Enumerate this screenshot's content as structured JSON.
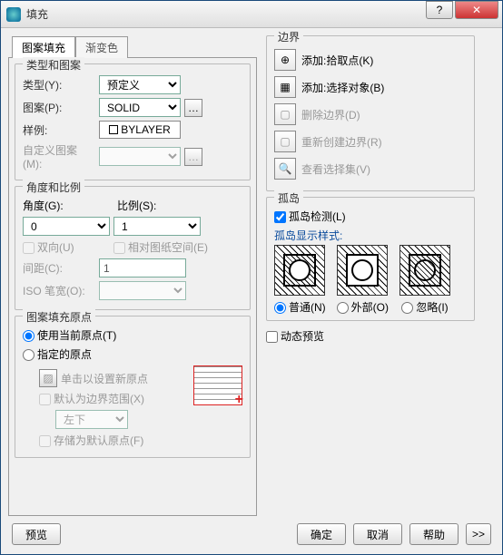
{
  "window": {
    "title": "填充"
  },
  "tabs": {
    "active": "图案填充",
    "inactive": "渐变色"
  },
  "type_pattern": {
    "title": "类型和图案",
    "type_label": "类型(Y):",
    "type_value": "预定义",
    "pattern_label": "图案(P):",
    "pattern_value": "SOLID",
    "sample_label": "样例:",
    "sample_value": "BYLAYER",
    "custom_label": "自定义图案(M):"
  },
  "angle_scale": {
    "title": "角度和比例",
    "angle_label": "角度(G):",
    "angle_value": "0",
    "scale_label": "比例(S):",
    "scale_value": "1",
    "double_label": "双向(U)",
    "paperspace_label": "相对图纸空间(E)",
    "spacing_label": "间距(C):",
    "spacing_value": "1",
    "isowidth_label": "ISO 笔宽(O):"
  },
  "origin": {
    "title": "图案填充原点",
    "use_current": "使用当前原点(T)",
    "specify": "指定的原点",
    "click_new": "单击以设置新原点",
    "default_bounds": "默认为边界范围(X)",
    "corner_value": "左下",
    "store_default": "存储为默认原点(F)"
  },
  "boundary": {
    "title": "边界",
    "pick_points": "添加:拾取点(K)",
    "select_objects": "添加:选择对象(B)",
    "remove": "删除边界(D)",
    "recreate": "重新创建边界(R)",
    "view_sel": "查看选择集(V)"
  },
  "islands": {
    "title": "孤岛",
    "detect": "孤岛检测(L)",
    "display_label": "孤岛显示样式:",
    "opt_normal": "普通(N)",
    "opt_outer": "外部(O)",
    "opt_ignore": "忽略(I)"
  },
  "dynamic_preview": "动态预览",
  "footer": {
    "preview": "预览",
    "ok": "确定",
    "cancel": "取消",
    "help": "帮助",
    "expand": ">>"
  }
}
